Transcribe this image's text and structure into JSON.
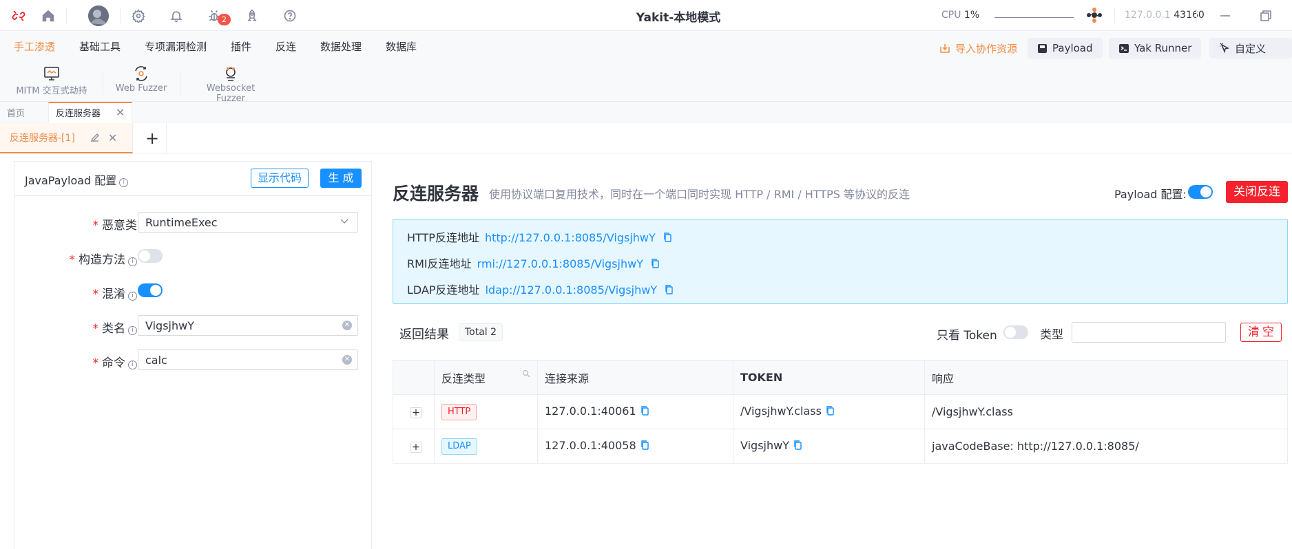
{
  "titlebar": {
    "title": "Yakit-本地模式",
    "bug_badge": "2",
    "cpu_label": "CPU",
    "cpu_value": "1%",
    "engine_host": "127.0.0.1",
    "engine_port": "43160"
  },
  "menu": {
    "items": [
      "手工渗透",
      "基础工具",
      "专项漏洞检测",
      "插件",
      "反连",
      "数据处理",
      "数据库"
    ],
    "tools": [
      "MITM 交互式劫持",
      "Web Fuzzer",
      "Websocket Fuzzer"
    ],
    "import_link": "导入协作资源",
    "payload_btn": "Payload",
    "yakrunner_btn": "Yak Runner",
    "custom_btn": "自定义"
  },
  "page_tabs": {
    "home": "首页",
    "active": "反连服务器"
  },
  "sub_tab": {
    "label": "反连服务器-[1]"
  },
  "java_payload": {
    "title": "JavaPayload 配置",
    "show_code": "显示代码",
    "generate": "生 成",
    "fields": {
      "malicious_class": {
        "label": "恶意类",
        "value": "RuntimeExec"
      },
      "constructor": {
        "label": "构造方法",
        "enabled": false
      },
      "obfuscate": {
        "label": "混淆",
        "enabled": true
      },
      "class_name": {
        "label": "类名",
        "value": "VigsjhwY"
      },
      "command": {
        "label": "命令",
        "value": "calc"
      }
    }
  },
  "reverse_server": {
    "title": "反连服务器",
    "description": "使用协议端口复用技术，同时在一个端口同时实现 HTTP / RMI / HTTPS 等协议的反连",
    "payload_config_label": "Payload 配置:",
    "payload_config_enabled": true,
    "close_button": "关闭反连",
    "addresses": [
      {
        "label": "HTTP反连地址",
        "url": "http://127.0.0.1:8085/VigsjhwY"
      },
      {
        "label": "RMI反连地址",
        "url": "rmi://127.0.0.1:8085/VigsjhwY"
      },
      {
        "label": "LDAP反连地址",
        "url": "ldap://127.0.0.1:8085/VigsjhwY"
      }
    ]
  },
  "results": {
    "label": "返回结果",
    "total": "Total 2",
    "token_only_label": "只看 Token",
    "type_label": "类型",
    "type_value": "",
    "clear": "清空",
    "columns": [
      "反连类型",
      "连接来源",
      "TOKEN",
      "响应"
    ],
    "rows": [
      {
        "type": "HTTP",
        "source": "127.0.0.1:40061",
        "token": "/VigsjhwY.class",
        "response": "/VigsjhwY.class"
      },
      {
        "type": "LDAP",
        "source": "127.0.0.1:40058",
        "token": "VigsjhwY",
        "response": "javaCodeBase: http://127.0.0.1:8085/"
      }
    ]
  },
  "colors": {
    "accent": "#f28b44",
    "primary": "#1890ff",
    "danger": "#f5222d",
    "text": "#31343f",
    "muted": "#85899e"
  }
}
